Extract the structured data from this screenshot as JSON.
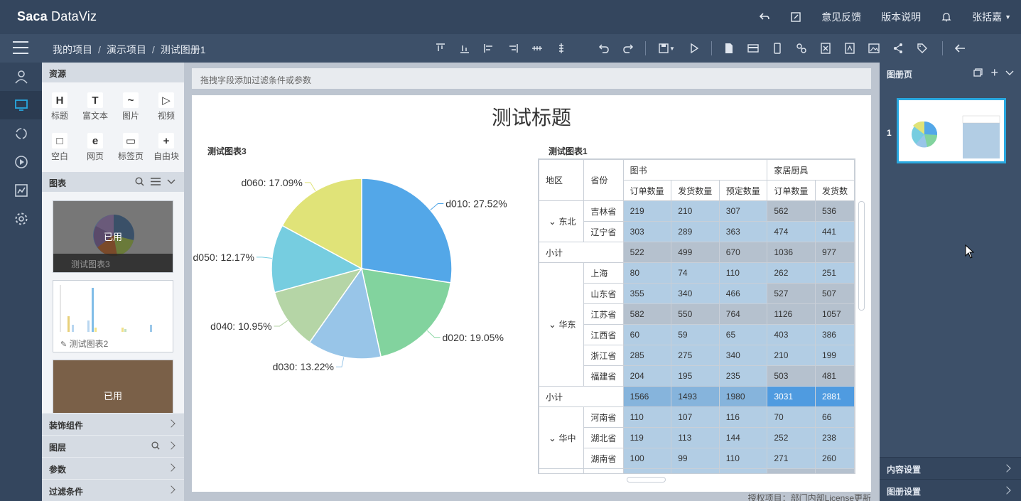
{
  "app": {
    "logo": {
      "brand": "Saca",
      "product": "DataViz"
    },
    "top_links": [
      "意见反馈",
      "版本说明"
    ],
    "user": "张括嘉"
  },
  "breadcrumb": [
    "我的项目",
    "演示项目",
    "测试图册1"
  ],
  "toolbar_icons": [
    "align-top-icon",
    "align-bottom-icon",
    "align-left-icon",
    "align-right-icon",
    "distribute-horizontal-icon",
    "distribute-vertical-icon",
    "undo-icon",
    "redo-icon",
    "save-icon",
    "play-icon",
    "document-icon",
    "card-icon",
    "mobile-icon",
    "link-icon",
    "excel-icon",
    "pdf-icon",
    "image-icon",
    "share-icon",
    "tag-icon",
    "back-icon"
  ],
  "left_panel": {
    "resources_title": "资源",
    "resources": [
      {
        "icon": "H",
        "label": "标题"
      },
      {
        "icon": "T",
        "label": "富文本"
      },
      {
        "icon": "~",
        "label": "图片"
      },
      {
        "icon": "▷",
        "label": "视频"
      },
      {
        "icon": "□",
        "label": "空白"
      },
      {
        "icon": "e",
        "label": "网页"
      },
      {
        "icon": "▭",
        "label": "标签页"
      },
      {
        "icon": "+",
        "label": "自由块"
      }
    ],
    "charts_title": "图表",
    "charts": [
      {
        "name": "测试图表3",
        "used_label": "已用"
      },
      {
        "name": "测试图表2"
      },
      {
        "used_label": "已用"
      }
    ],
    "sections": [
      "装饰组件",
      "图层",
      "参数",
      "过滤条件"
    ]
  },
  "filter_bar": "拖拽字段添加过滤条件或参数",
  "canvas": {
    "title": "测试标题",
    "chart3_title": "测试图表3",
    "chart1_title": "测试图表1",
    "license": "授权项目：部门内部License更新"
  },
  "chart_data": {
    "type": "pie",
    "categories": [
      "d010",
      "d020",
      "d030",
      "d040",
      "d050",
      "d060"
    ],
    "values": [
      27.52,
      19.05,
      13.22,
      10.95,
      12.17,
      17.09
    ],
    "labels": [
      "d010: 27.52%",
      "d020: 19.05%",
      "d030: 13.22%",
      "d040: 10.95%",
      "d050: 12.17%",
      "d060: 17.09%"
    ],
    "colors": [
      "#53a7e8",
      "#82d39e",
      "#98c5e8",
      "#b5d5a6",
      "#76cde0",
      "#e0e378"
    ]
  },
  "pivot": {
    "header_region": "地区",
    "header_province": "省份",
    "groups": [
      "图书",
      "家居厨具"
    ],
    "measures": [
      "订单数量",
      "发货数量",
      "预定数量",
      "订单数量",
      "发货数"
    ],
    "subtotal_label": "小计",
    "regions": [
      {
        "name": "东北",
        "rows": [
          {
            "province": "吉林省",
            "values": [
              "219",
              "210",
              "307",
              "562",
              "536"
            ],
            "shade": [
              "val",
              "val",
              "val",
              "valg",
              "valg"
            ]
          },
          {
            "province": "辽宁省",
            "values": [
              "303",
              "289",
              "363",
              "474",
              "441"
            ],
            "shade": [
              "val",
              "val",
              "val",
              "val",
              "val"
            ]
          }
        ],
        "subtotal": [
          "522",
          "499",
          "670",
          "1036",
          "977"
        ],
        "sub_shade": [
          "valg",
          "valg",
          "valg",
          "valg",
          "valg"
        ]
      },
      {
        "name": "华东",
        "rows": [
          {
            "province": "上海",
            "values": [
              "80",
              "74",
              "110",
              "262",
              "251"
            ],
            "shade": [
              "val",
              "val",
              "val",
              "val",
              "val"
            ]
          },
          {
            "province": "山东省",
            "values": [
              "355",
              "340",
              "466",
              "527",
              "507"
            ],
            "shade": [
              "val",
              "val",
              "val",
              "valg",
              "valg"
            ]
          },
          {
            "province": "江苏省",
            "values": [
              "582",
              "550",
              "764",
              "1126",
              "1057"
            ],
            "shade": [
              "valg",
              "valg",
              "valg",
              "valg",
              "valg"
            ]
          },
          {
            "province": "江西省",
            "values": [
              "60",
              "59",
              "65",
              "403",
              "386"
            ],
            "shade": [
              "val",
              "val",
              "val",
              "val",
              "val"
            ]
          },
          {
            "province": "浙江省",
            "values": [
              "285",
              "275",
              "340",
              "210",
              "199"
            ],
            "shade": [
              "val",
              "val",
              "val",
              "val",
              "val"
            ]
          },
          {
            "province": "福建省",
            "values": [
              "204",
              "195",
              "235",
              "503",
              "481"
            ],
            "shade": [
              "val",
              "val",
              "val",
              "valg",
              "valg"
            ]
          }
        ],
        "subtotal": [
          "1566",
          "1493",
          "1980",
          "3031",
          "2881"
        ],
        "sub_shade": [
          "sub",
          "sub",
          "sub",
          "sub2",
          "sub2"
        ]
      },
      {
        "name": "华中",
        "rows": [
          {
            "province": "河南省",
            "values": [
              "110",
              "107",
              "116",
              "70",
              "66"
            ],
            "shade": [
              "val",
              "val",
              "val",
              "val",
              "val"
            ]
          },
          {
            "province": "湖北省",
            "values": [
              "119",
              "113",
              "144",
              "252",
              "238"
            ],
            "shade": [
              "val",
              "val",
              "val",
              "val",
              "val"
            ]
          },
          {
            "province": "湖南省",
            "values": [
              "100",
              "99",
              "110",
              "271",
              "260"
            ],
            "shade": [
              "val",
              "val",
              "val",
              "val",
              "val"
            ]
          }
        ]
      }
    ]
  },
  "right_panel": {
    "title": "图册页",
    "page_number": "1",
    "sections": [
      "内容设置",
      "图册设置"
    ]
  }
}
